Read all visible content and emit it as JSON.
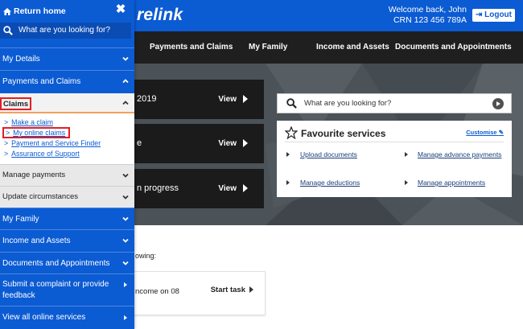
{
  "header": {
    "brand_fragment": "relink",
    "welcome": "Welcome back, John",
    "crn": "CRN 123 456 789A",
    "logout_label": "Logout"
  },
  "nav": {
    "items": [
      "Payments and Claims",
      "My Family",
      "Income and Assets",
      "Documents and Appointments"
    ]
  },
  "hero_tiles": [
    {
      "text": "2019",
      "view_label": "View"
    },
    {
      "text": "e",
      "view_label": "View"
    },
    {
      "text": "n progress",
      "view_label": "View"
    }
  ],
  "main_search": {
    "placeholder": "What are you looking for?"
  },
  "favourites": {
    "title": "Favourite services",
    "customise_label": "Customise",
    "links": [
      "Upload documents",
      "Manage advance payments",
      "Manage deductions",
      "Manage appointments"
    ]
  },
  "tasks": {
    "intro_fragment": "owing:",
    "card_text": "ncome on 08",
    "start_label": "Start task"
  },
  "drawer": {
    "home_label": "Return home",
    "close_glyph": "✖",
    "search_placeholder": "What are you looking for?",
    "items": [
      {
        "label": "My Details",
        "state": "collapsed"
      },
      {
        "label": "Payments and Claims",
        "state": "expanded"
      },
      {
        "label": "Claims",
        "state": "expanded",
        "highlighted": true
      },
      {
        "label": "Manage payments",
        "state": "collapsed"
      },
      {
        "label": "Update circumstances",
        "state": "collapsed"
      },
      {
        "label": "My Family",
        "state": "collapsed"
      },
      {
        "label": "Income and Assets",
        "state": "collapsed"
      },
      {
        "label": "Documents and Appointments",
        "state": "collapsed"
      },
      {
        "label": "Submit a complaint or provide feedback",
        "state": "link"
      },
      {
        "label": "View all online services",
        "state": "link"
      }
    ],
    "claims_links": [
      {
        "label": "Make a claim",
        "selected": false
      },
      {
        "label": "My online claims",
        "selected": true
      },
      {
        "label": "Payment and Service Finder",
        "selected": false
      },
      {
        "label": "Assurance of Support",
        "selected": false
      }
    ]
  },
  "colors": {
    "brand_blue": "#0b5bd3",
    "nav_dark": "#1f1f1f",
    "highlight_red": "#e31e24"
  }
}
